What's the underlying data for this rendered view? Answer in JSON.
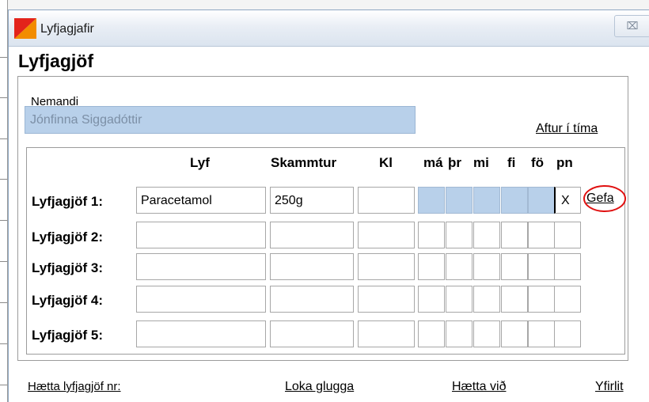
{
  "window": {
    "title": "Lyfjagjafir",
    "close_glyph": "⌧"
  },
  "form": {
    "heading": "Lyfjagjöf",
    "student_label": "Nemandi",
    "student_value": "Jónfinna Siggadóttir",
    "back_link": "Aftur í tíma"
  },
  "table": {
    "headers": {
      "drug": "Lyf",
      "dose": "Skammtur",
      "time": "Kl",
      "days": [
        "má",
        "þr",
        "mi",
        "fi",
        "fö",
        "pn"
      ]
    },
    "rows": [
      {
        "label": "Lyfjagjöf 1:",
        "drug": "Paracetamol",
        "dose": "250g",
        "time": "",
        "days": [
          "",
          "",
          "",
          "",
          "",
          "X"
        ],
        "day_highlight": [
          true,
          true,
          true,
          true,
          true,
          false
        ]
      },
      {
        "label": "Lyfjagjöf 2:",
        "drug": "",
        "dose": "",
        "time": "",
        "days": [
          "",
          "",
          "",
          "",
          "",
          ""
        ],
        "day_highlight": [
          false,
          false,
          false,
          false,
          false,
          false
        ]
      },
      {
        "label": "Lyfjagjöf 3:",
        "drug": "",
        "dose": "",
        "time": "",
        "days": [
          "",
          "",
          "",
          "",
          "",
          ""
        ],
        "day_highlight": [
          false,
          false,
          false,
          false,
          false,
          false
        ]
      },
      {
        "label": "Lyfjagjöf 4:",
        "drug": "",
        "dose": "",
        "time": "",
        "days": [
          "",
          "",
          "",
          "",
          "",
          ""
        ],
        "day_highlight": [
          false,
          false,
          false,
          false,
          false,
          false
        ]
      },
      {
        "label": "Lyfjagjöf 5:",
        "drug": "",
        "dose": "",
        "time": "",
        "days": [
          "",
          "",
          "",
          "",
          "",
          ""
        ],
        "day_highlight": [
          false,
          false,
          false,
          false,
          false,
          false
        ]
      }
    ],
    "give_link": "Gefa"
  },
  "footer": {
    "stop_nr": "Hætta lyfjagjöf nr:",
    "close_window": "Loka glugga",
    "cancel": "Hætta við",
    "overview": "Yfirlit"
  },
  "colors": {
    "highlight": "#b8d0ea",
    "annotation_circle": "#e01010",
    "icon_orange": "#f28c00",
    "icon_red": "#e3231b"
  },
  "icons": {
    "app": "app-logo-icon",
    "close": "close-icon"
  }
}
